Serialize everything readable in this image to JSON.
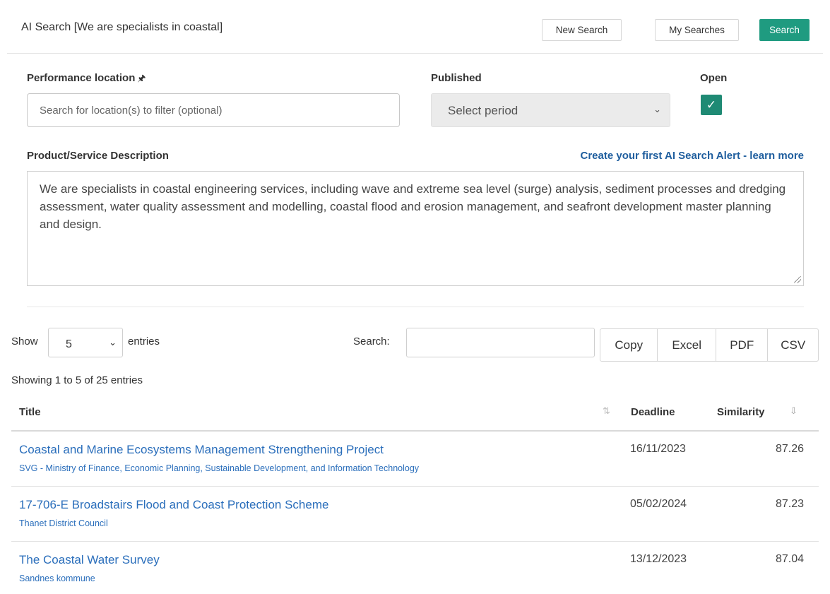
{
  "header": {
    "title": "AI Search [We are specialists in coastal]",
    "new_search": "New Search",
    "my_searches": "My Searches",
    "search": "Search"
  },
  "filters": {
    "location_label": "Performance location",
    "location_pin_icon": "pin-icon",
    "location_placeholder": "Search for location(s) to filter (optional)",
    "published_label": "Published",
    "published_value": "Select period",
    "open_label": "Open",
    "open_checked": true,
    "checkmark": "✓"
  },
  "description": {
    "label": "Product/Service Description",
    "alert_link": "Create your first AI Search Alert - learn more",
    "text": "We are specialists in coastal engineering services, including wave and extreme sea level (surge) analysis, sediment processes and dredging assessment, water quality assessment and modelling, coastal flood and erosion management, and seafront development master planning and design."
  },
  "table_controls": {
    "show_label": "Show",
    "page_size": "5",
    "entries_label": "entries",
    "search_label": "Search:",
    "search_value": "",
    "export": [
      "Copy",
      "Excel",
      "PDF",
      "CSV"
    ],
    "info": "Showing 1 to 5 of 25 entries"
  },
  "table": {
    "columns": [
      "Title",
      "Deadline",
      "Similarity"
    ],
    "rows": [
      {
        "title": "Coastal and Marine Ecosystems Management Strengthening Project",
        "buyer": "SVG - Ministry of Finance, Economic Planning, Sustainable Development, and Information Technology",
        "deadline": "16/11/2023",
        "similarity": "87.26"
      },
      {
        "title": "17-706-E Broadstairs Flood and Coast Protection Scheme",
        "buyer": "Thanet District Council",
        "deadline": "05/02/2024",
        "similarity": "87.23"
      },
      {
        "title": "The Coastal Water Survey",
        "buyer": "Sandnes kommune",
        "deadline": "13/12/2023",
        "similarity": "87.04"
      }
    ]
  },
  "colors": {
    "accent": "#1f9b80",
    "link": "#2a6ebb",
    "alert_link": "#1f5e9e"
  }
}
